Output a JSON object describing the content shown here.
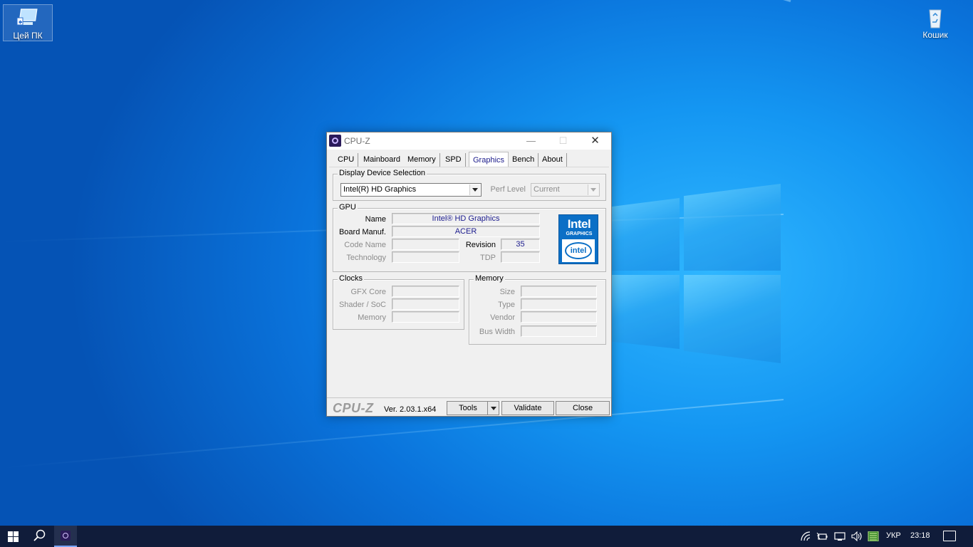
{
  "desktop": {
    "icons": [
      {
        "label": "Цей ПК"
      },
      {
        "label": "Кошик"
      }
    ]
  },
  "window": {
    "title": "CPU-Z",
    "controls": {
      "minimize": "—",
      "maximize": "☐",
      "close": "✕"
    },
    "tabs": [
      "CPU",
      "Mainboard",
      "Memory",
      "SPD",
      "Graphics",
      "Bench",
      "About"
    ],
    "active_tab": "Graphics",
    "display_device": {
      "group_title": "Display Device Selection",
      "selected": "Intel(R) HD Graphics",
      "perf_level_label": "Perf Level",
      "perf_level_value": "Current"
    },
    "gpu": {
      "group_title": "GPU",
      "name_label": "Name",
      "name_value": "Intel® HD Graphics",
      "board_label": "Board Manuf.",
      "board_value": "ACER",
      "codename_label": "Code Name",
      "codename_value": "",
      "revision_label": "Revision",
      "revision_value": "35",
      "technology_label": "Technology",
      "technology_value": "",
      "tdp_label": "TDP",
      "tdp_value": "",
      "badge": {
        "line1": "Intel",
        "line2": "GRAPHICS",
        "oval": "intel"
      }
    },
    "clocks": {
      "group_title": "Clocks",
      "gfx_core_label": "GFX Core",
      "shader_label": "Shader / SoC",
      "memory_label": "Memory"
    },
    "memory": {
      "group_title": "Memory",
      "size_label": "Size",
      "type_label": "Type",
      "vendor_label": "Vendor",
      "bus_width_label": "Bus Width"
    },
    "footer": {
      "brand": "CPU-Z",
      "version": "Ver. 2.03.1.x64",
      "tools_label": "Tools",
      "validate_label": "Validate",
      "close_label": "Close"
    }
  },
  "taskbar": {
    "language": "УКР",
    "time": "23:18"
  },
  "colors": {
    "value_text": "#1c1c8e",
    "intel_blue": "#0b6fc6",
    "taskbar": "#101c3a"
  }
}
